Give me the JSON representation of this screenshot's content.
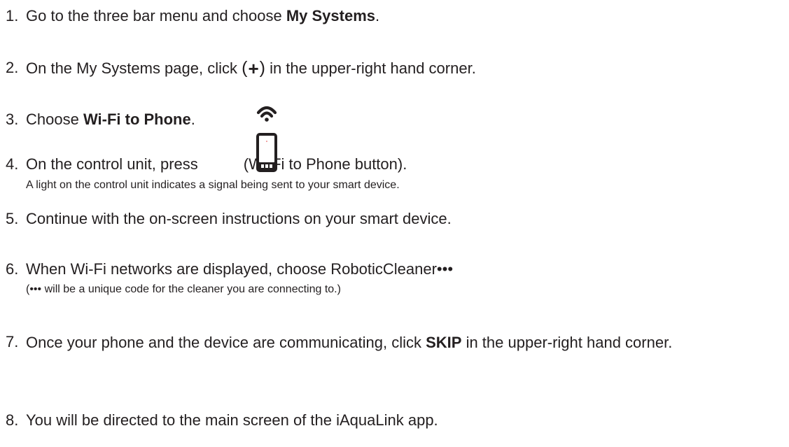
{
  "steps": [
    {
      "number": "1.",
      "text_before": "Go to the three bar menu and choose ",
      "bold": "My Systems",
      "text_after": "."
    },
    {
      "number": "2.",
      "text_before": "On the My Systems page, click ",
      "paren_open": "(",
      "plus_symbol": "+",
      "paren_close": ")",
      "text_after": " in the upper-right hand corner."
    },
    {
      "number": "3.",
      "text_before": "Choose ",
      "bold": "Wi-Fi to Phone",
      "text_after": "."
    },
    {
      "number": "4.",
      "text_before": "On the control unit, press",
      "text_after": "(Wi-Fi to Phone button).",
      "icon": "wifi-phone-icon",
      "note": "A light on the control unit indicates a signal being sent to your smart device."
    },
    {
      "number": "5.",
      "text": "Continue with the on-screen instructions on your smart device."
    },
    {
      "number": "6.",
      "text": "When Wi-Fi networks are displayed, choose RoboticCleaner•••",
      "note": "(••• will be a unique code for the cleaner you are connecting to.)"
    },
    {
      "number": "7.",
      "text_before": "Once your phone and the device are communicating, click ",
      "bold": "SKIP",
      "text_after": " in the upper-right hand corner."
    },
    {
      "number": "8.",
      "text": "You will be directed to the main screen of the iAquaLink app."
    }
  ]
}
